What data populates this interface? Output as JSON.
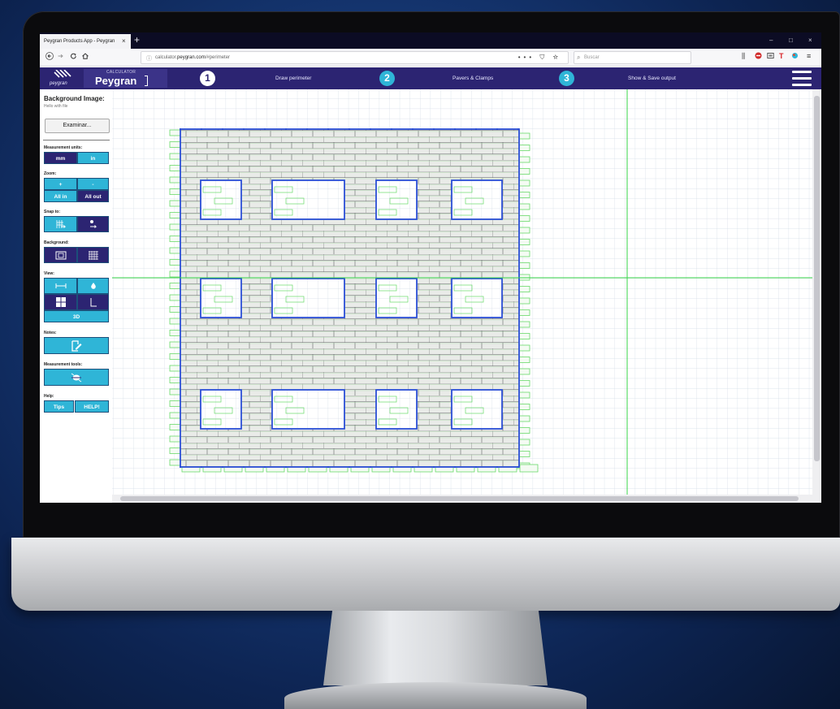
{
  "browser": {
    "tab_title": "Peygran Products App - Peygran",
    "tab_close": "×",
    "new_tab": "+",
    "url_prefix": "calculator.",
    "url_domain": "peygran.com",
    "url_path": "/#perimeter",
    "search_placeholder": "Buscar",
    "page_actions": "••• ⛉ ☆",
    "window_minimize": "–",
    "window_maximize": "□",
    "window_close": "×"
  },
  "header": {
    "logo_text": "peygran",
    "brand_small": "CALCULATOR",
    "brand_name": "Peygran",
    "steps": [
      {
        "number": "1",
        "label": "Draw perimeter"
      },
      {
        "number": "2",
        "label": "Pavers & Clamps"
      },
      {
        "number": "3",
        "label": "Show & Save output"
      }
    ],
    "active_step": 1
  },
  "sidebar": {
    "background_image_title": "Background Image:",
    "background_image_hint": "Hello with file",
    "file_button": "Examinar...",
    "measurement_units_label": "Measurement units:",
    "unit_mm": "mm",
    "unit_in": "in",
    "zoom_label": "Zoom:",
    "zoom_in": "+",
    "zoom_out": "-",
    "zoom_all_in": "All in",
    "zoom_all_out": "All out",
    "snap_label": "Snap to:",
    "background_label": "Background:",
    "view_label": "View:",
    "view_3d": "3D",
    "notes_label": "Notes:",
    "measurement_tools_label": "Measurement tools:",
    "help_label": "Help:",
    "tips_button": "Tips",
    "help_button": "HELP!"
  },
  "colors": {
    "header_bg": "#2c2472",
    "accent_teal": "#2fb5d7",
    "perimeter_blue": "#2b4fd6",
    "guide_green": "#38d448",
    "grid_line": "#d3dde6",
    "paver_fill": "#e9ebe8"
  },
  "icons": {
    "back": "arrow-left-icon",
    "forward": "arrow-right-icon",
    "reload": "reload-icon",
    "home": "home-icon",
    "menu": "hamburger-icon"
  }
}
